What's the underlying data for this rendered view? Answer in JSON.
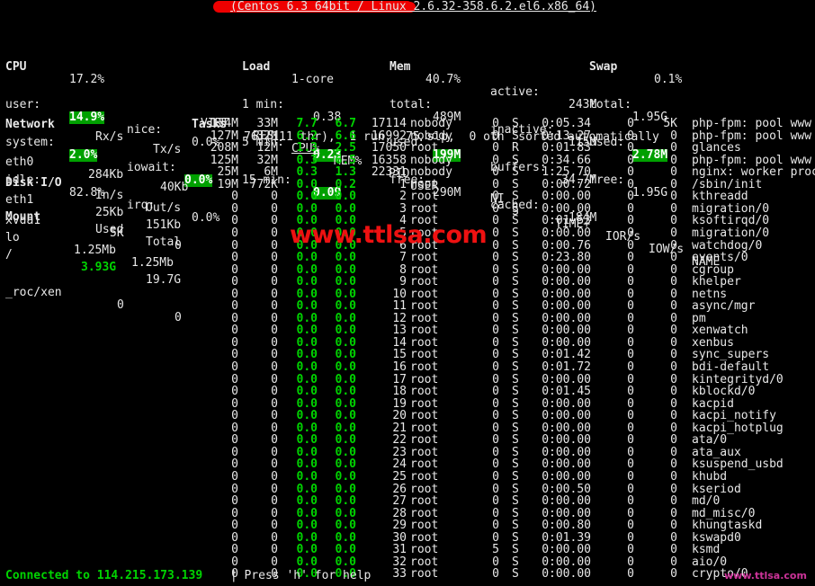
{
  "window": {
    "title_suffix": "(Centos 6.3 64bit / Linux 2.6.32-358.6.2.el6.x86_64)",
    "redacted": true
  },
  "colors": {
    "background": "#000000",
    "foreground": "#e8e8e8",
    "accent_green": "#00d400",
    "highlight_bg": "#00a000",
    "watermark_red": "#ee1111",
    "watermark_pink": "#cc3399",
    "redaction_red": "#ee0000"
  },
  "cpu": {
    "title": "CPU",
    "total": "17.2%",
    "rows": [
      {
        "label": "user:",
        "value": "14.9%",
        "highlight": true,
        "label2": "nice:",
        "value2": "0.0%",
        "highlight2": false
      },
      {
        "label": "system:",
        "value": "2.0%",
        "highlight": true,
        "label2": "iowait:",
        "value2": "0.0%",
        "highlight2": true
      },
      {
        "label": "idle:",
        "value": "82.8%",
        "highlight": false,
        "label2": "irq:",
        "value2": "0.0%",
        "highlight2": false
      }
    ]
  },
  "load": {
    "title": "Load",
    "cores": "1-core",
    "rows": [
      {
        "label": "1 min:",
        "value": "0.38",
        "highlight": false
      },
      {
        "label": "5 min:",
        "value": "0.23",
        "highlight": true
      },
      {
        "label": "15 min:",
        "value": "0.09",
        "highlight": true
      }
    ]
  },
  "mem": {
    "title": "Mem",
    "percent": "40.7%",
    "rows": [
      {
        "label": "total:",
        "value": "489M",
        "highlight": false,
        "label2": "active:",
        "value2": "243M"
      },
      {
        "label": "used:",
        "value": "199M",
        "highlight": true,
        "label2": "inactive:",
        "value2": "115M"
      },
      {
        "label": "free:",
        "value": "290M",
        "highlight": false,
        "label2": "buffers:",
        "value2": "34.7M"
      }
    ],
    "extra_row": {
      "label2": "cached:",
      "value2": "184M"
    }
  },
  "swap": {
    "title": "Swap",
    "percent": "0.1%",
    "rows": [
      {
        "label": "total:",
        "value": "1.95G",
        "highlight": false
      },
      {
        "label": "used:",
        "value": "2.78M",
        "highlight": true
      },
      {
        "label": "free:",
        "value": "1.95G",
        "highlight": false
      }
    ]
  },
  "network": {
    "title": "Network",
    "col_rx": "Rx/s",
    "col_tx": "Tx/s",
    "rows": [
      {
        "iface": "eth0",
        "rx": "284Kb",
        "tx": "40Kb"
      },
      {
        "iface": "eth1",
        "rx": "25Kb",
        "tx": "151Kb"
      },
      {
        "iface": "lo",
        "rx": "1.25Mb",
        "tx": "1.25Mb"
      }
    ]
  },
  "diskio": {
    "title": "Disk I/O",
    "col_in": "In/s",
    "col_out": "Out/s",
    "rows": [
      {
        "disk": "xvda1",
        "in": "5K",
        "out": "0"
      }
    ]
  },
  "mount": {
    "title": "Mount",
    "col_used": "Used",
    "col_total": "Total",
    "rows": [
      {
        "mnt": "/",
        "used": "3.93G",
        "used_green": true,
        "total": "19.7G"
      },
      {
        "mnt": "_roc/xen",
        "used": "0",
        "used_green": false,
        "total": "0"
      }
    ]
  },
  "tasks": {
    "title": "Tasks",
    "summary": "76 (111 thr),  1 run,  75 slp,  0 oth  sorted automatically"
  },
  "process_table": {
    "headers": {
      "virt": "VIRT",
      "res": "RES",
      "cpu": "CPU%",
      "mem": "MEM%",
      "pid": "PID",
      "user": "USER",
      "ni": "NI",
      "s": "S",
      "time": "TIME+",
      "ior": "IOR/s",
      "iow": "IOW/s",
      "name": "NAME"
    },
    "sorted_column": "CPU%",
    "rows": [
      {
        "virt": "134M",
        "res": "33M",
        "cpu": "7.7",
        "mem": "6.7",
        "pid": "17114",
        "user": "nobody",
        "ni": "0",
        "s": "S",
        "time": "0:05.34",
        "ior": "0",
        "iow": "5K",
        "name": "php-fpm: pool www"
      },
      {
        "virt": "127M",
        "res": "32M",
        "cpu": "6.2",
        "mem": "6.6",
        "pid": "16992",
        "user": "nobody",
        "ni": "0",
        "s": "S",
        "time": "0:13.27",
        "ior": "0",
        "iow": "0",
        "name": "php-fpm: pool www"
      },
      {
        "virt": "208M",
        "res": "12M",
        "cpu": "1.3",
        "mem": "2.5",
        "pid": "17050",
        "user": "root",
        "ni": "0",
        "s": "R",
        "time": "0:01.83",
        "ior": "0",
        "iow": "0",
        "name": "glances"
      },
      {
        "virt": "125M",
        "res": "32M",
        "cpu": "0.3",
        "mem": "6.5",
        "pid": "16358",
        "user": "nobody",
        "ni": "0",
        "s": "S",
        "time": "0:34.66",
        "ior": "0",
        "iow": "0",
        "name": "php-fpm: pool www"
      },
      {
        "virt": "25M",
        "res": "6M",
        "cpu": "0.3",
        "mem": "1.3",
        "pid": "22331",
        "user": "nobody",
        "ni": "0",
        "s": "S",
        "time": "1:25.70",
        "ior": "0",
        "iow": "0",
        "name": "nginx: worker proce"
      },
      {
        "virt": "19M",
        "res": "772K",
        "cpu": "0.0",
        "mem": "0.2",
        "pid": "1",
        "user": "root",
        "ni": "0",
        "s": "S",
        "time": "0:00.72",
        "ior": "0",
        "iow": "0",
        "name": "/sbin/init"
      },
      {
        "virt": "0",
        "res": "0",
        "cpu": "0.0",
        "mem": "0.0",
        "pid": "2",
        "user": "root",
        "ni": "0",
        "s": "S",
        "time": "0:00.00",
        "ior": "0",
        "iow": "0",
        "name": "kthreadd"
      },
      {
        "virt": "0",
        "res": "0",
        "cpu": "0.0",
        "mem": "0.0",
        "pid": "3",
        "user": "root",
        "ni": "0",
        "s": "S",
        "time": "0:00.00",
        "ior": "0",
        "iow": "0",
        "name": "migration/0"
      },
      {
        "virt": "0",
        "res": "0",
        "cpu": "0.0",
        "mem": "0.0",
        "pid": "4",
        "user": "root",
        "ni": "0",
        "s": "S",
        "time": "0:01.53",
        "ior": "0",
        "iow": "0",
        "name": "ksoftirqd/0"
      },
      {
        "virt": "0",
        "res": "0",
        "cpu": "0.0",
        "mem": "0.0",
        "pid": "5",
        "user": "root",
        "ni": "0",
        "s": "S",
        "time": "0:00.00",
        "ior": "0",
        "iow": "0",
        "name": "migration/0"
      },
      {
        "virt": "0",
        "res": "0",
        "cpu": "0.0",
        "mem": "0.0",
        "pid": "6",
        "user": "root",
        "ni": "0",
        "s": "S",
        "time": "0:00.76",
        "ior": "0",
        "iow": "0",
        "name": "watchdog/0"
      },
      {
        "virt": "0",
        "res": "0",
        "cpu": "0.0",
        "mem": "0.0",
        "pid": "7",
        "user": "root",
        "ni": "0",
        "s": "S",
        "time": "0:23.80",
        "ior": "0",
        "iow": "0",
        "name": "events/0"
      },
      {
        "virt": "0",
        "res": "0",
        "cpu": "0.0",
        "mem": "0.0",
        "pid": "8",
        "user": "root",
        "ni": "0",
        "s": "S",
        "time": "0:00.00",
        "ior": "0",
        "iow": "0",
        "name": "cgroup"
      },
      {
        "virt": "0",
        "res": "0",
        "cpu": "0.0",
        "mem": "0.0",
        "pid": "9",
        "user": "root",
        "ni": "0",
        "s": "S",
        "time": "0:00.00",
        "ior": "0",
        "iow": "0",
        "name": "khelper"
      },
      {
        "virt": "0",
        "res": "0",
        "cpu": "0.0",
        "mem": "0.0",
        "pid": "10",
        "user": "root",
        "ni": "0",
        "s": "S",
        "time": "0:00.00",
        "ior": "0",
        "iow": "0",
        "name": "netns"
      },
      {
        "virt": "0",
        "res": "0",
        "cpu": "0.0",
        "mem": "0.0",
        "pid": "11",
        "user": "root",
        "ni": "0",
        "s": "S",
        "time": "0:00.00",
        "ior": "0",
        "iow": "0",
        "name": "async/mgr"
      },
      {
        "virt": "0",
        "res": "0",
        "cpu": "0.0",
        "mem": "0.0",
        "pid": "12",
        "user": "root",
        "ni": "0",
        "s": "S",
        "time": "0:00.00",
        "ior": "0",
        "iow": "0",
        "name": "pm"
      },
      {
        "virt": "0",
        "res": "0",
        "cpu": "0.0",
        "mem": "0.0",
        "pid": "13",
        "user": "root",
        "ni": "0",
        "s": "S",
        "time": "0:00.00",
        "ior": "0",
        "iow": "0",
        "name": "xenwatch"
      },
      {
        "virt": "0",
        "res": "0",
        "cpu": "0.0",
        "mem": "0.0",
        "pid": "14",
        "user": "root",
        "ni": "0",
        "s": "S",
        "time": "0:00.00",
        "ior": "0",
        "iow": "0",
        "name": "xenbus"
      },
      {
        "virt": "0",
        "res": "0",
        "cpu": "0.0",
        "mem": "0.0",
        "pid": "15",
        "user": "root",
        "ni": "0",
        "s": "S",
        "time": "0:01.42",
        "ior": "0",
        "iow": "0",
        "name": "sync_supers"
      },
      {
        "virt": "0",
        "res": "0",
        "cpu": "0.0",
        "mem": "0.0",
        "pid": "16",
        "user": "root",
        "ni": "0",
        "s": "S",
        "time": "0:01.72",
        "ior": "0",
        "iow": "0",
        "name": "bdi-default"
      },
      {
        "virt": "0",
        "res": "0",
        "cpu": "0.0",
        "mem": "0.0",
        "pid": "17",
        "user": "root",
        "ni": "0",
        "s": "S",
        "time": "0:00.00",
        "ior": "0",
        "iow": "0",
        "name": "kintegrityd/0"
      },
      {
        "virt": "0",
        "res": "0",
        "cpu": "0.0",
        "mem": "0.0",
        "pid": "18",
        "user": "root",
        "ni": "0",
        "s": "S",
        "time": "0:01.45",
        "ior": "0",
        "iow": "0",
        "name": "kblockd/0"
      },
      {
        "virt": "0",
        "res": "0",
        "cpu": "0.0",
        "mem": "0.0",
        "pid": "19",
        "user": "root",
        "ni": "0",
        "s": "S",
        "time": "0:00.00",
        "ior": "0",
        "iow": "0",
        "name": "kacpid"
      },
      {
        "virt": "0",
        "res": "0",
        "cpu": "0.0",
        "mem": "0.0",
        "pid": "20",
        "user": "root",
        "ni": "0",
        "s": "S",
        "time": "0:00.00",
        "ior": "0",
        "iow": "0",
        "name": "kacpi_notify"
      },
      {
        "virt": "0",
        "res": "0",
        "cpu": "0.0",
        "mem": "0.0",
        "pid": "21",
        "user": "root",
        "ni": "0",
        "s": "S",
        "time": "0:00.00",
        "ior": "0",
        "iow": "0",
        "name": "kacpi_hotplug"
      },
      {
        "virt": "0",
        "res": "0",
        "cpu": "0.0",
        "mem": "0.0",
        "pid": "22",
        "user": "root",
        "ni": "0",
        "s": "S",
        "time": "0:00.00",
        "ior": "0",
        "iow": "0",
        "name": "ata/0"
      },
      {
        "virt": "0",
        "res": "0",
        "cpu": "0.0",
        "mem": "0.0",
        "pid": "23",
        "user": "root",
        "ni": "0",
        "s": "S",
        "time": "0:00.00",
        "ior": "0",
        "iow": "0",
        "name": "ata_aux"
      },
      {
        "virt": "0",
        "res": "0",
        "cpu": "0.0",
        "mem": "0.0",
        "pid": "24",
        "user": "root",
        "ni": "0",
        "s": "S",
        "time": "0:00.00",
        "ior": "0",
        "iow": "0",
        "name": "ksuspend_usbd"
      },
      {
        "virt": "0",
        "res": "0",
        "cpu": "0.0",
        "mem": "0.0",
        "pid": "25",
        "user": "root",
        "ni": "0",
        "s": "S",
        "time": "0:00.00",
        "ior": "0",
        "iow": "0",
        "name": "khubd"
      },
      {
        "virt": "0",
        "res": "0",
        "cpu": "0.0",
        "mem": "0.0",
        "pid": "26",
        "user": "root",
        "ni": "0",
        "s": "S",
        "time": "0:00.50",
        "ior": "0",
        "iow": "0",
        "name": "kseriod"
      },
      {
        "virt": "0",
        "res": "0",
        "cpu": "0.0",
        "mem": "0.0",
        "pid": "27",
        "user": "root",
        "ni": "0",
        "s": "S",
        "time": "0:00.00",
        "ior": "0",
        "iow": "0",
        "name": "md/0"
      },
      {
        "virt": "0",
        "res": "0",
        "cpu": "0.0",
        "mem": "0.0",
        "pid": "28",
        "user": "root",
        "ni": "0",
        "s": "S",
        "time": "0:00.00",
        "ior": "0",
        "iow": "0",
        "name": "md_misc/0"
      },
      {
        "virt": "0",
        "res": "0",
        "cpu": "0.0",
        "mem": "0.0",
        "pid": "29",
        "user": "root",
        "ni": "0",
        "s": "S",
        "time": "0:00.80",
        "ior": "0",
        "iow": "0",
        "name": "khungtaskd"
      },
      {
        "virt": "0",
        "res": "0",
        "cpu": "0.0",
        "mem": "0.0",
        "pid": "30",
        "user": "root",
        "ni": "0",
        "s": "S",
        "time": "0:01.39",
        "ior": "0",
        "iow": "0",
        "name": "kswapd0"
      },
      {
        "virt": "0",
        "res": "0",
        "cpu": "0.0",
        "mem": "0.0",
        "pid": "31",
        "user": "root",
        "ni": "5",
        "s": "S",
        "time": "0:00.00",
        "ior": "0",
        "iow": "0",
        "name": "ksmd"
      },
      {
        "virt": "0",
        "res": "0",
        "cpu": "0.0",
        "mem": "0.0",
        "pid": "32",
        "user": "root",
        "ni": "0",
        "s": "S",
        "time": "0:00.00",
        "ior": "0",
        "iow": "0",
        "name": "aio/0"
      },
      {
        "virt": "0",
        "res": "0",
        "cpu": "0.0",
        "mem": "0.0",
        "pid": "33",
        "user": "root",
        "ni": "0",
        "s": "S",
        "time": "0:00.00",
        "ior": "0",
        "iow": "0",
        "name": "crypto/0"
      }
    ]
  },
  "status_bar": {
    "connected": "Connected to 114.215.173.139",
    "separator_and_help": " | Press 'h' for help"
  },
  "watermarks": {
    "center": "www.ttlsa.com",
    "corner": "www.ttlsa.com"
  }
}
